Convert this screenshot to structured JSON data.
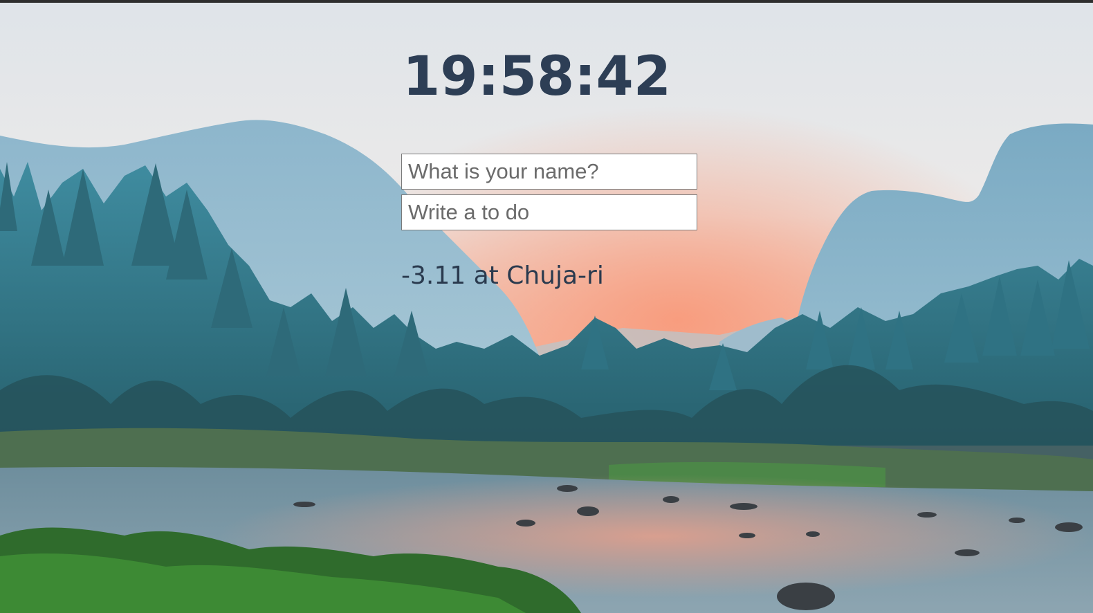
{
  "clock": {
    "time": "19:58:42"
  },
  "greeting_form": {
    "name_placeholder": "What is your name?"
  },
  "todo_form": {
    "todo_placeholder": "Write a to do"
  },
  "weather": {
    "text": "-3.11 at Chuja-ri"
  },
  "background": {
    "scene": "mountain-river-landscape",
    "sky_color": "#e9ebee",
    "glow_color": "#f4a489",
    "mountain_color": "#6fa4c0",
    "forest_color": "#2f6f80",
    "water_color": "#7b98a8",
    "grass_color": "#3f7a3a"
  }
}
